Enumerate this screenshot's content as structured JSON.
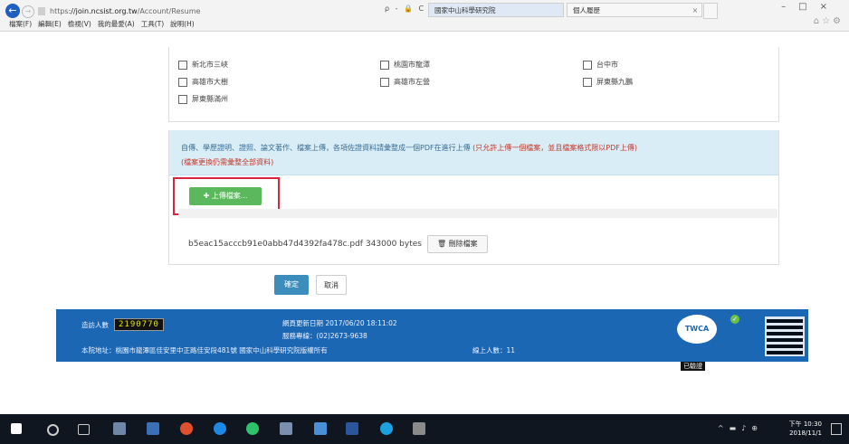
{
  "browser": {
    "url_scheme": "https",
    "url_host": "://join.ncsist.org.tw",
    "url_path": "/Account/Resume",
    "address_actions": "ρ - 🔒 C",
    "tabs": [
      {
        "label": "國家中山科學研究院",
        "active": true
      },
      {
        "label": "個人履歷",
        "active": false
      }
    ],
    "menu": [
      "檔案(F)",
      "編輯(E)",
      "檢視(V)",
      "我的最愛(A)",
      "工具(T)",
      "說明(H)"
    ]
  },
  "locations": [
    {
      "label": "新北市三峽"
    },
    {
      "label": "桃園市龍潭"
    },
    {
      "label": "台中市"
    },
    {
      "label": "高雄市大樹"
    },
    {
      "label": "高雄市左營"
    },
    {
      "label": "屏東縣九鵬"
    },
    {
      "label": "屏東縣滿州"
    }
  ],
  "notice": {
    "text": "自傳、學歷證明、證照、論文著作、檔案上傳，各項佐證資料請彙整成一個PDF在進行上傳",
    "highlight": "(只允許上傳一個檔案，並且檔案格式限以PDF上傳)",
    "note": "(檔案更換仍需彙整全部資料)"
  },
  "upload": {
    "label": "上傳檔案..."
  },
  "file": {
    "name": "b5eac15acccb91e0abb47d4392fa478c.pdf",
    "size": "343000 bytes",
    "delete_label": "刪除檔案"
  },
  "actions": {
    "confirm": "確定",
    "cancel": "取消"
  },
  "footer": {
    "visits_label": "造訪人數",
    "visits_count": "2190770",
    "updated": "網頁更新日期 2017/06/20 18:11:02",
    "phone": "服務專線：(02)2673-9638",
    "address": "本院地址：桃園市龍潭區佳安里中正路佳安段481號 國家中山科學研究院版權所有",
    "online_label": "線上人數：",
    "online_count": "11",
    "badge_text": "TWCA",
    "badge_label": "已驗證"
  },
  "taskbar": {
    "time": "下午 10:30",
    "date": "2018/11/1"
  }
}
